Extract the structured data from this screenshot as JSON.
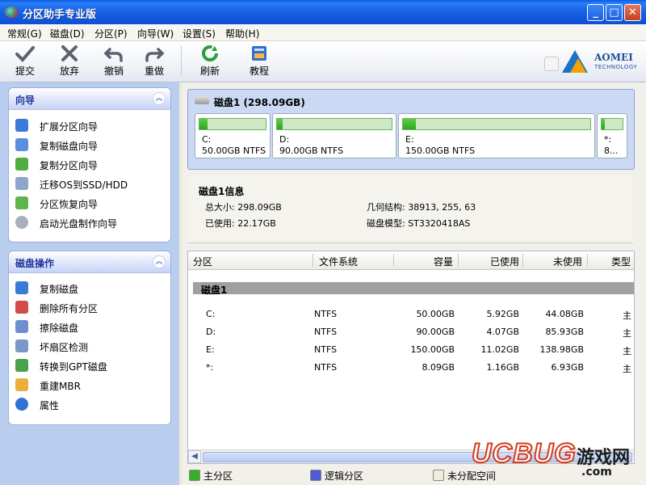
{
  "window": {
    "title": "分区助手专业版"
  },
  "menu": [
    "常规(G)",
    "磁盘(D)",
    "分区(P)",
    "向导(W)",
    "设置(S)",
    "帮助(H)"
  ],
  "toolbar": {
    "submit": "提交",
    "discard": "放弃",
    "undo": "撤销",
    "redo": "重做",
    "refresh": "刷新",
    "tutorial": "教程"
  },
  "logo": {
    "name": "AOMEI",
    "sub": "TECHNOLOGY"
  },
  "wizard_panel": {
    "title": "向导",
    "items": [
      "扩展分区向导",
      "复制磁盘向导",
      "复制分区向导",
      "迁移OS到SSD/HDD",
      "分区恢复向导",
      "启动光盘制作向导"
    ]
  },
  "disk_ops_panel": {
    "title": "磁盘操作",
    "items": [
      "复制磁盘",
      "删除所有分区",
      "擦除磁盘",
      "坏扇区检测",
      "转换到GPT磁盘",
      "重建MBR",
      "属性"
    ]
  },
  "disk_map": {
    "header": "磁盘1 (298.09GB)",
    "partitions": [
      {
        "name": "C:",
        "desc": "50.00GB NTFS",
        "used_fraction": 0.12
      },
      {
        "name": "D:",
        "desc": "90.00GB NTFS",
        "used_fraction": 0.05
      },
      {
        "name": "E:",
        "desc": "150.00GB NTFS",
        "used_fraction": 0.07
      },
      {
        "name": "*:",
        "desc": "8...",
        "used_fraction": 0.14
      }
    ]
  },
  "disk_info": {
    "title": "磁盘1信息",
    "total_label": "总大小: 298.09GB",
    "used_label": "已使用: 22.17GB",
    "geometry_label": "几何结构: 38913, 255, 63",
    "model_label": "磁盘模型: ST3320418AS"
  },
  "table": {
    "columns": [
      "分区",
      "文件系统",
      "容量",
      "已使用",
      "未使用",
      "类型"
    ],
    "group": "磁盘1",
    "rows": [
      {
        "part": "C:",
        "fs": "NTFS",
        "cap": "50.00GB",
        "used": "5.92GB",
        "free": "44.08GB",
        "type": "主"
      },
      {
        "part": "D:",
        "fs": "NTFS",
        "cap": "90.00GB",
        "used": "4.07GB",
        "free": "85.93GB",
        "type": "主"
      },
      {
        "part": "E:",
        "fs": "NTFS",
        "cap": "150.00GB",
        "used": "11.02GB",
        "free": "138.98GB",
        "type": "主"
      },
      {
        "part": "*:",
        "fs": "NTFS",
        "cap": "8.09GB",
        "used": "1.16GB",
        "free": "6.93GB",
        "type": "主"
      }
    ]
  },
  "legend": {
    "primary": "主分区",
    "logical": "逻辑分区",
    "unallocated": "未分配空间"
  },
  "colors": {
    "primary": "#34b028",
    "logical": "#4e5dd6",
    "unallocated": "#f0ecdc"
  },
  "watermark": {
    "brand": "UCBUG",
    "cn": "游戏网",
    "domain": ".com"
  }
}
